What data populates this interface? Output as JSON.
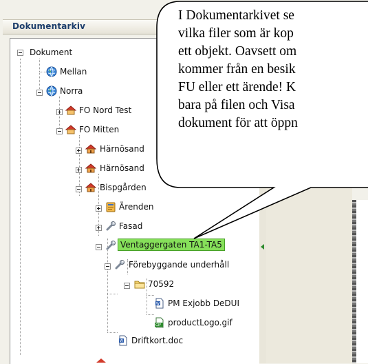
{
  "panel": {
    "title": "Dokumentarkiv"
  },
  "tree": {
    "root": "Dokument",
    "mellan": "Mellan",
    "norra": "Norra",
    "fo_nord_test": "FO Nord Test",
    "fo_mitten": "FO Mitten",
    "harnosand_1": "Härnösand",
    "harnosand_2": "Härnösand",
    "bispgarden": "Bispgården",
    "arenden": "Ärenden",
    "fasad": "Fasad",
    "ventaggergaten": "Ventaggergaten TA1-TA5",
    "forebyggande": "Förebyggande underhåll",
    "folder_70592": "70592",
    "pm_exjobb": "PM Exjobb DeDUI",
    "product_logo": "productLogo.gif",
    "driftkort": "Driftkort.doc"
  },
  "callout": {
    "lines": [
      "I Dokumentarkivet se",
      "vilka filer som är kop",
      "ett objekt. Oavsett om",
      "kommer från en besik",
      "FU eller ett ärende! K",
      "bara på filen och Visa",
      "dokument för att öppn"
    ]
  }
}
